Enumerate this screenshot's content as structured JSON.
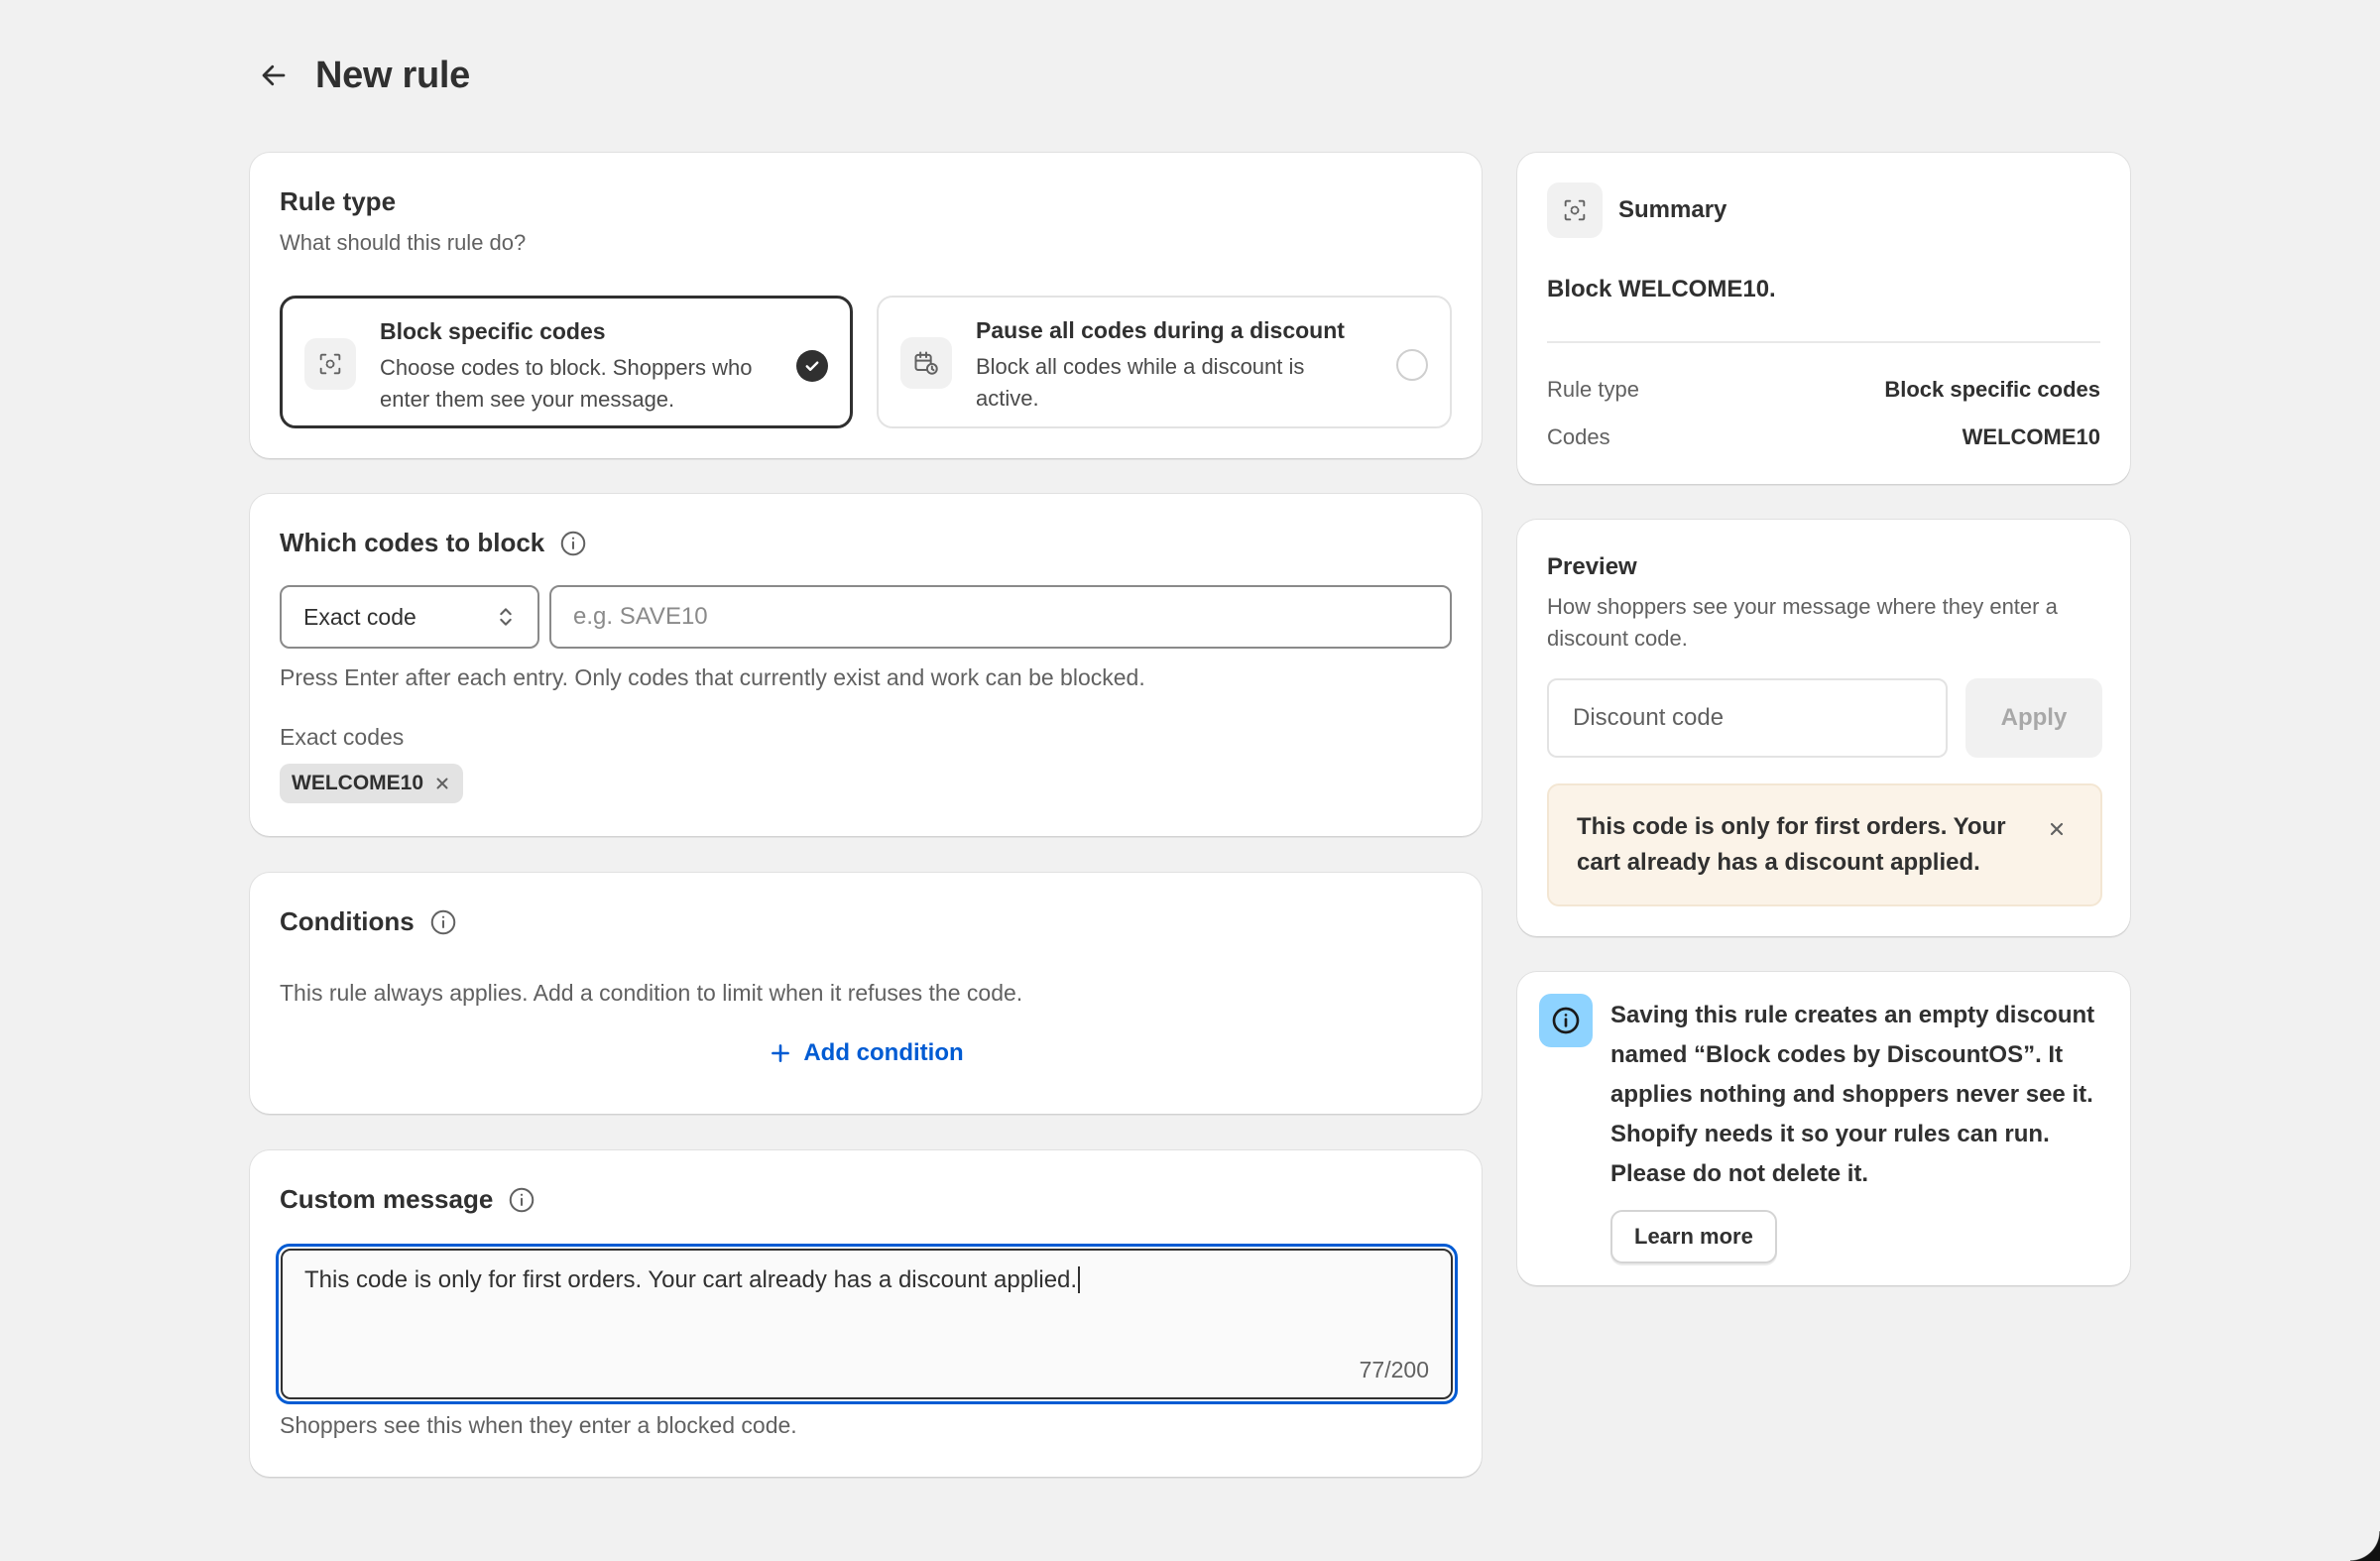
{
  "header": {
    "title": "New rule"
  },
  "rule_type": {
    "title": "Rule type",
    "subtitle": "What should this rule do?",
    "options": [
      {
        "title": "Block specific codes",
        "description": "Choose codes to block. Shoppers who enter them see your message.",
        "selected": true
      },
      {
        "title": "Pause all codes during a discount",
        "description": "Block all codes while a discount is active.",
        "selected": false
      }
    ]
  },
  "codes": {
    "title": "Which codes to block",
    "match_type": "Exact code",
    "input_placeholder": "e.g. SAVE10",
    "help": "Press Enter after each entry. Only codes that currently exist and work can be blocked.",
    "list_label": "Exact codes",
    "tags": [
      "WELCOME10"
    ]
  },
  "conditions": {
    "title": "Conditions",
    "description": "This rule always applies. Add a condition to limit when it refuses the code.",
    "add_label": "Add condition"
  },
  "message": {
    "title": "Custom message",
    "value": "This code is only for first orders. Your cart already has a discount applied.",
    "counter": "77/200",
    "help": "Shoppers see this when they enter a blocked code."
  },
  "summary": {
    "title": "Summary",
    "line": "Block WELCOME10.",
    "rows": [
      {
        "key": "Rule type",
        "value": "Block specific codes"
      },
      {
        "key": "Codes",
        "value": "WELCOME10"
      }
    ]
  },
  "preview": {
    "title": "Preview",
    "subtitle": "How shoppers see your message where they enter a discount code.",
    "input_placeholder": "Discount code",
    "apply_label": "Apply",
    "notice": "This code is only for first orders. Your cart already has a discount applied."
  },
  "info": {
    "text": "Saving this rule creates an empty discount named “Block codes by DiscountOS”. It applies nothing and shoppers never see it. Shopify needs it so your rules can run. Please do not delete it.",
    "button_label": "Learn more"
  },
  "colors": {
    "accent": "#005bd3",
    "info_badge": "#8ed3ff",
    "notice_bg": "#fbf3e8",
    "page_bg": "#f1f1f1"
  }
}
